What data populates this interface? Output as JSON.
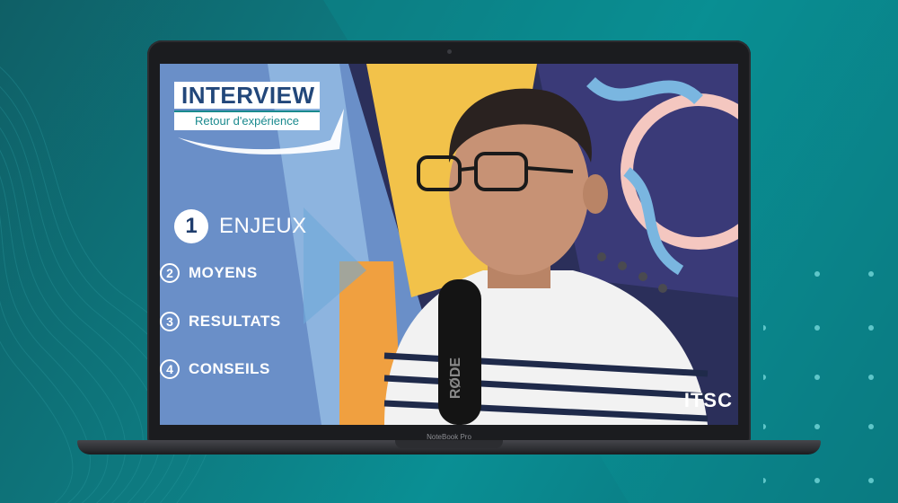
{
  "laptop": {
    "model_label": "NoteBook Pro"
  },
  "video": {
    "logo_title": "INTERVIEW",
    "logo_subtitle": "Retour d'expérience",
    "active_item": {
      "number": "1",
      "label": "ENJEUX"
    },
    "items": [
      {
        "number": "2",
        "label": "MOYENS"
      },
      {
        "number": "3",
        "label": "RESULTATS"
      },
      {
        "number": "4",
        "label": "CONSEILS"
      }
    ],
    "watermark": "ITSC",
    "mic_brand": "RØDE"
  },
  "colors": {
    "background": "#0e7a80",
    "accent_blue": "#22477a",
    "accent_teal": "#1a8a8e"
  }
}
